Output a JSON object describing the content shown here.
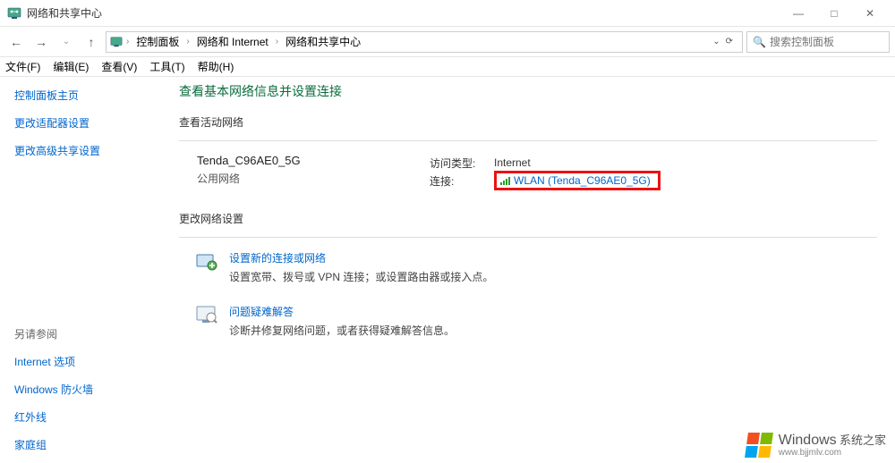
{
  "window": {
    "title": "网络和共享中心",
    "min": "—",
    "max": "□",
    "close": "✕"
  },
  "nav": {
    "back": "←",
    "fwd": "→",
    "up": "↑"
  },
  "breadcrumb": {
    "items": [
      "控制面板",
      "网络和 Internet",
      "网络和共享中心"
    ],
    "sep": "›",
    "dropdown": "⌄",
    "refresh": "⟳"
  },
  "search": {
    "placeholder": "搜索控制面板",
    "icon": "🔍"
  },
  "menu": {
    "file": "文件(F)",
    "edit": "编辑(E)",
    "view": "查看(V)",
    "tools": "工具(T)",
    "help": "帮助(H)"
  },
  "sidebar": {
    "home": "控制面板主页",
    "adapter": "更改适配器设置",
    "advanced": "更改高级共享设置",
    "see_also_hdr": "另请参阅",
    "see_also": {
      "internet_options": "Internet 选项",
      "firewall": "Windows 防火墙",
      "infrared": "红外线",
      "homegroup": "家庭组"
    }
  },
  "main": {
    "heading": "查看基本网络信息并设置连接",
    "active_hdr": "查看活动网络",
    "network": {
      "name": "Tenda_C96AE0_5G",
      "type": "公用网络",
      "access_label": "访问类型:",
      "access_value": "Internet",
      "conn_label": "连接:",
      "conn_value": "WLAN (Tenda_C96AE0_5G)"
    },
    "change_hdr": "更改网络设置",
    "items": [
      {
        "title": "设置新的连接或网络",
        "desc": "设置宽带、拨号或 VPN 连接；或设置路由器或接入点。"
      },
      {
        "title": "问题疑难解答",
        "desc": "诊断并修复网络问题，或者获得疑难解答信息。"
      }
    ]
  },
  "watermark": {
    "brand": "Windows",
    "sub": "系统之家",
    "url": "www.bjjmlv.com"
  }
}
